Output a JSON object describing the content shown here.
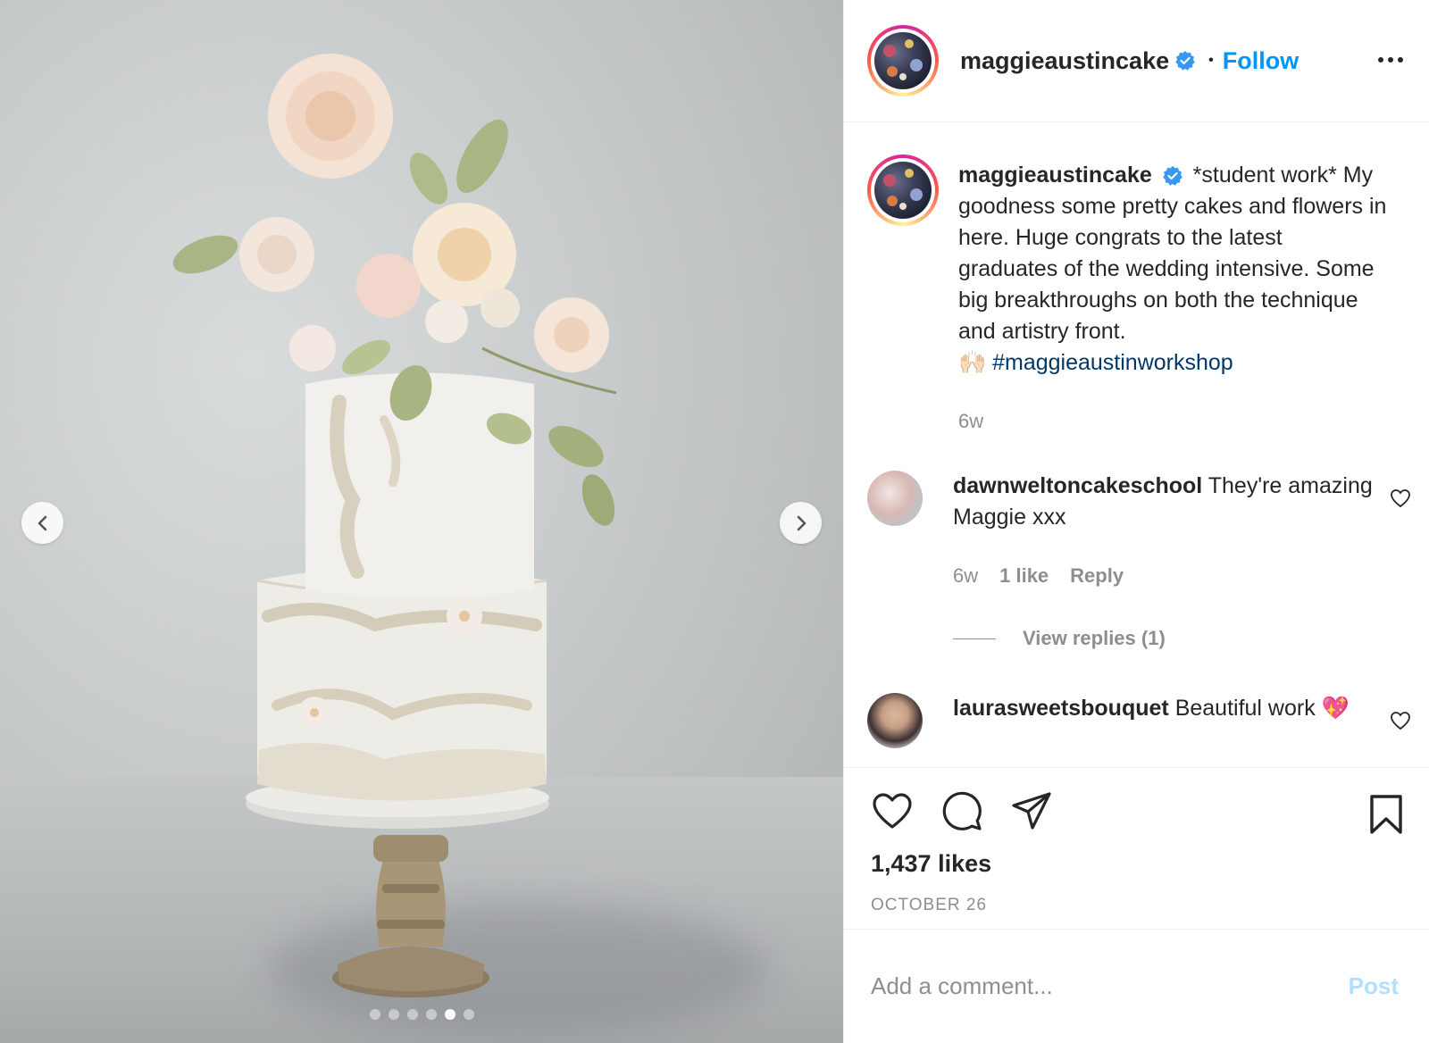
{
  "post": {
    "username": "maggieaustincake",
    "verified": true,
    "follow_label": "Follow",
    "separator": "•",
    "more_icon": "more-horizontal-icon"
  },
  "media": {
    "carousel_dots": 6,
    "active_dot": 5,
    "prev_icon": "chevron-left-icon",
    "next_icon": "chevron-right-icon"
  },
  "caption": {
    "username": "maggieaustincake",
    "text": "*student work* My goodness some pretty cakes and flowers in here. Huge congrats to the latest graduates of the wedding intensive. Some big breakthroughs on both the technique and artistry front.",
    "emoji": "🙌🏻",
    "hashtag": "#maggieaustinworkshop",
    "time": "6w"
  },
  "comments": [
    {
      "username": "dawnweltoncakeschool",
      "text": "They're amazing Maggie xxx",
      "time": "6w",
      "likes": "1 like",
      "reply_label": "Reply",
      "view_replies": "View replies (1)"
    },
    {
      "username": "laurasweetsbouquet",
      "text": "Beautiful work",
      "emoji": "💖"
    }
  ],
  "actions": {
    "like_icon": "heart-icon",
    "comment_icon": "comment-icon",
    "share_icon": "send-icon",
    "save_icon": "bookmark-icon",
    "likes": "1,437 likes",
    "date": "OCTOBER 26"
  },
  "add_comment": {
    "placeholder": "Add a comment...",
    "post_label": "Post"
  },
  "colors": {
    "link_blue": "#0095f6",
    "hashtag": "#00376b",
    "muted": "#8e8e8e",
    "post_disabled": "#b2dffc"
  }
}
